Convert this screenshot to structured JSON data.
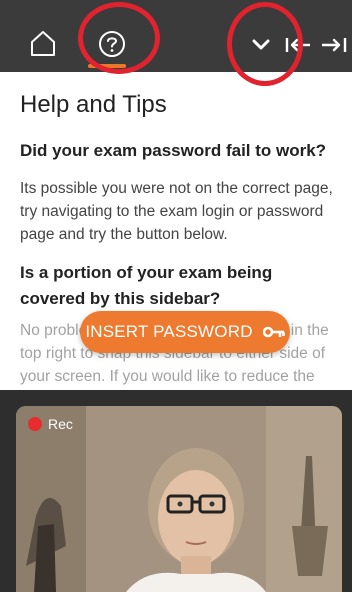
{
  "toolbar": {
    "icons": {
      "home": "home-icon",
      "help": "help-circle-icon",
      "collapse": "chevron-down-icon",
      "dock_left": "dock-left-icon",
      "dock_right": "dock-right-icon"
    },
    "background": "#3b3b3b",
    "accent": "#e9782c",
    "annotation_color": "#e0232e"
  },
  "help": {
    "title": "Help and Tips",
    "q1": "Did your exam password fail to work?",
    "a1": "Its possible you were not on the correct page, try navigating to the exam login or password page and try the button below.",
    "q2": "Is a portion of your exam being covered by this sidebar?",
    "a2": "No problem, use the arrow icons |←→| in the top right to snap this sidebar to either side of your screen. If you would like to reduce the"
  },
  "insert_button": {
    "label": "INSERT PASSWORD",
    "icon": "key-icon",
    "color": "#ee7a2f"
  },
  "camera": {
    "rec_label": "Rec",
    "rec_color": "#e62e2e"
  }
}
